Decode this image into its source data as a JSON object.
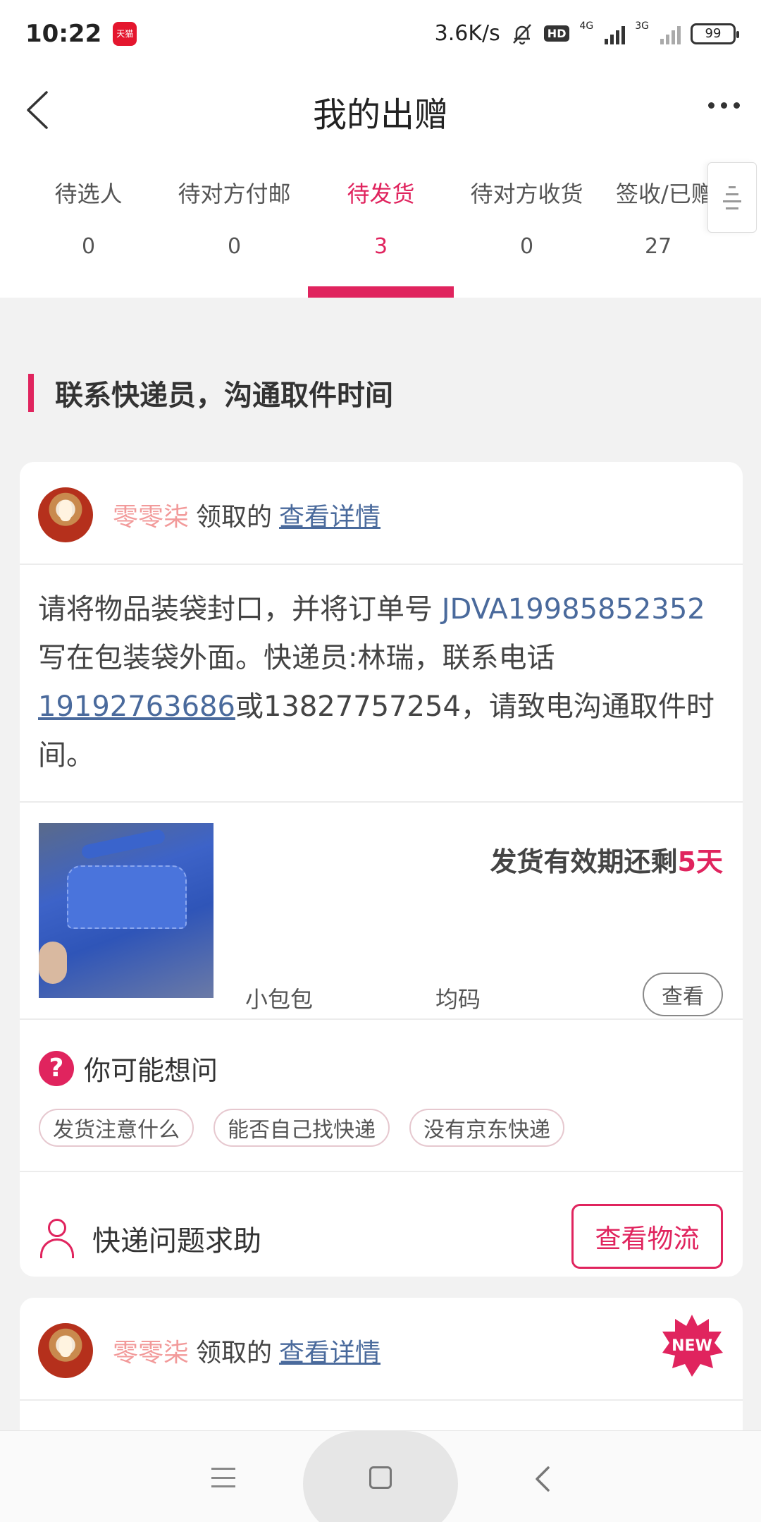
{
  "status_bar": {
    "time": "10:22",
    "app_badge": "天猫",
    "net_speed": "3.6K/s",
    "hd": "HD",
    "net1": "4G",
    "net2": "3G",
    "battery": "99"
  },
  "header": {
    "title": "我的出赠",
    "back_icon": "chevron-left-icon",
    "more_icon": "more-dots-icon"
  },
  "tabs": [
    {
      "label": "待选人",
      "count": "0"
    },
    {
      "label": "待对方付邮",
      "count": "0"
    },
    {
      "label": "待发货",
      "count": "3",
      "active": true
    },
    {
      "label": "待对方收货",
      "count": "0"
    },
    {
      "label": "签收/已赠",
      "count": "27"
    }
  ],
  "section": {
    "heading": "联系快递员，沟通取件时间"
  },
  "card1": {
    "user_name": "零零柒",
    "took_text": "领取的",
    "detail_link": "查看详情",
    "instructions": {
      "part1": "请将物品装袋封口，并将订单号 ",
      "order_no": "JDVA19985852352",
      "part2": " 写在包装袋外面。快递员:林瑞，联系电话",
      "phone": "19192763686",
      "part3": "或13827757254，请致电沟通取件时间。"
    },
    "validity_text": "发货有效期还剩",
    "validity_days": "5天",
    "product_name": "小包包",
    "product_size": "均码",
    "view_button": "查看",
    "faq_title": "你可能想问",
    "faq_chips": [
      "发货注意什么",
      "能否自己找快递",
      "没有京东快递"
    ],
    "help_text": "快递问题求助",
    "logistics_button": "查看物流"
  },
  "card2": {
    "user_name": "零零柒",
    "took_text": "领取的",
    "detail_link": "查看详情",
    "badge": "NEW"
  },
  "colors": {
    "accent": "#e0245e",
    "link": "#4a6a9c",
    "username": "#f29a9a"
  }
}
